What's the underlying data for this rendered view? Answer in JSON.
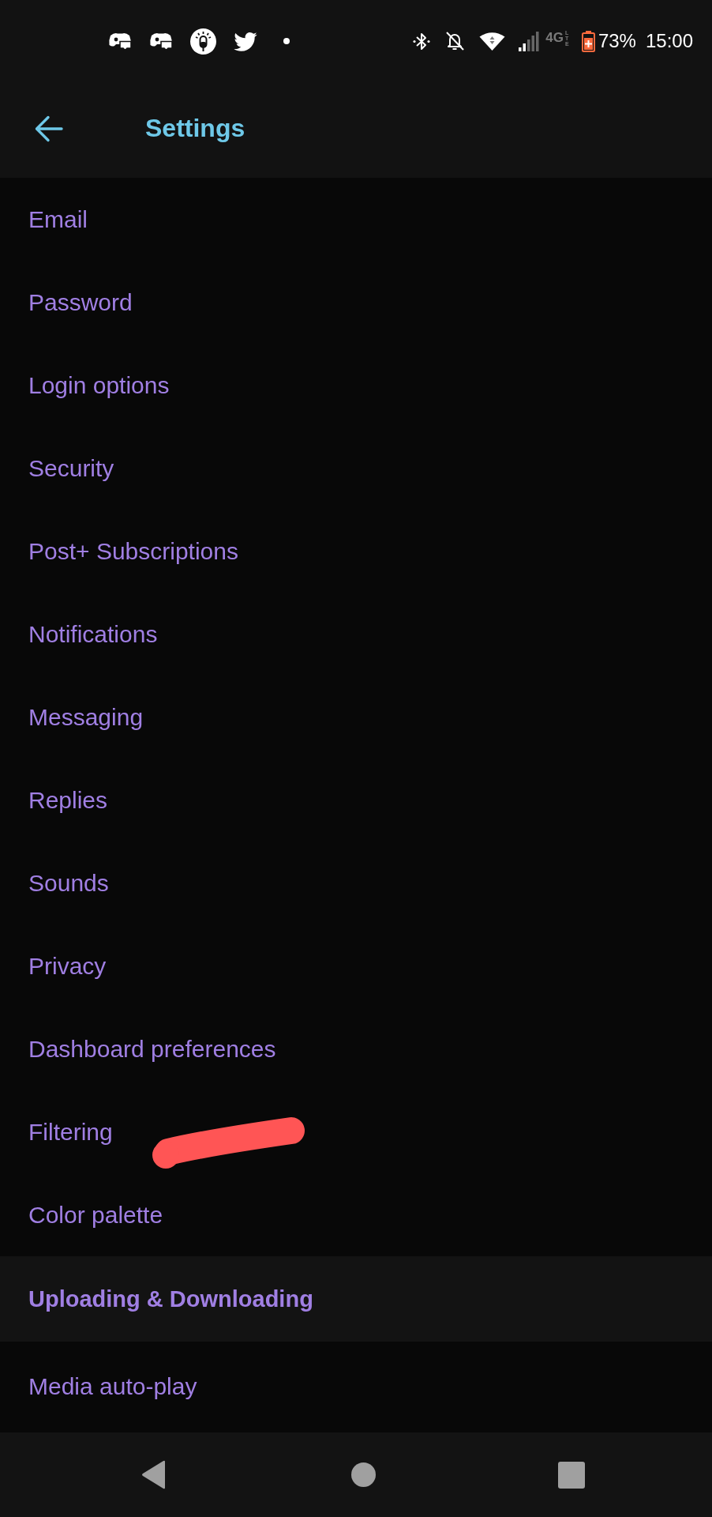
{
  "status_bar": {
    "network_type": "4G",
    "network_subtype": "LTE",
    "battery": "73%",
    "time": "15:00"
  },
  "header": {
    "title": "Settings"
  },
  "settings_list": [
    {
      "kind": "item",
      "label": "Email"
    },
    {
      "kind": "item",
      "label": "Password"
    },
    {
      "kind": "item",
      "label": "Login options"
    },
    {
      "kind": "item",
      "label": "Security"
    },
    {
      "kind": "item",
      "label": "Post+ Subscriptions"
    },
    {
      "kind": "item",
      "label": "Notifications"
    },
    {
      "kind": "item",
      "label": "Messaging"
    },
    {
      "kind": "item",
      "label": "Replies"
    },
    {
      "kind": "item",
      "label": "Sounds"
    },
    {
      "kind": "item",
      "label": "Privacy"
    },
    {
      "kind": "item",
      "label": "Dashboard preferences"
    },
    {
      "kind": "item",
      "label": "Filtering"
    },
    {
      "kind": "item",
      "label": "Color palette"
    },
    {
      "kind": "section",
      "label": "Uploading & Downloading"
    },
    {
      "kind": "item",
      "label": "Media auto-play"
    }
  ]
}
